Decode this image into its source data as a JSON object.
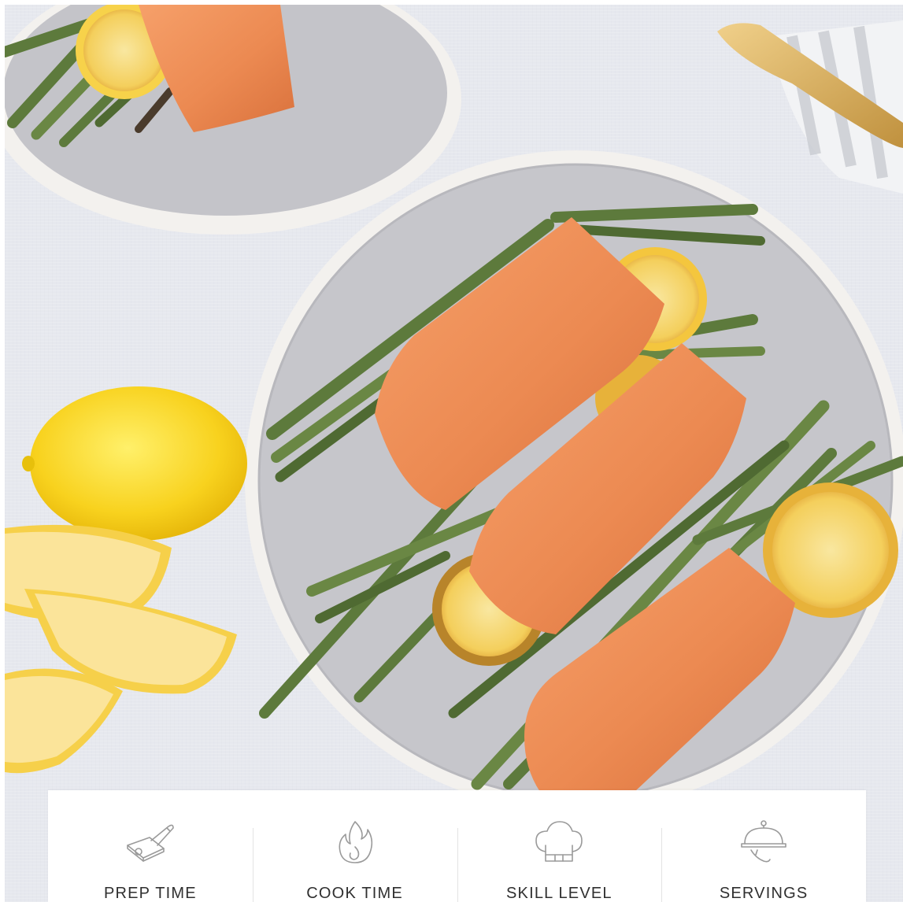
{
  "hero": {
    "subject": "baked salmon fillets with roasted asparagus and lemon",
    "colors": {
      "tablecloth": "#e6e8ee",
      "plate": "#c4c4c9",
      "plate_rim": "#f3f1ee",
      "salmon": "#ec8a52",
      "asparagus": "#5d7a3c",
      "lemon": "#f8d21e",
      "knife": "#d8b05c"
    }
  },
  "stats": {
    "icon_color": "#9a9a9a",
    "items": [
      {
        "icon": "cutting-board-knife-icon",
        "label": "PREP TIME"
      },
      {
        "icon": "flame-icon",
        "label": "COOK TIME"
      },
      {
        "icon": "chef-hat-icon",
        "label": "SKILL LEVEL"
      },
      {
        "icon": "serving-cloche-icon",
        "label": "SERVINGS"
      }
    ]
  }
}
